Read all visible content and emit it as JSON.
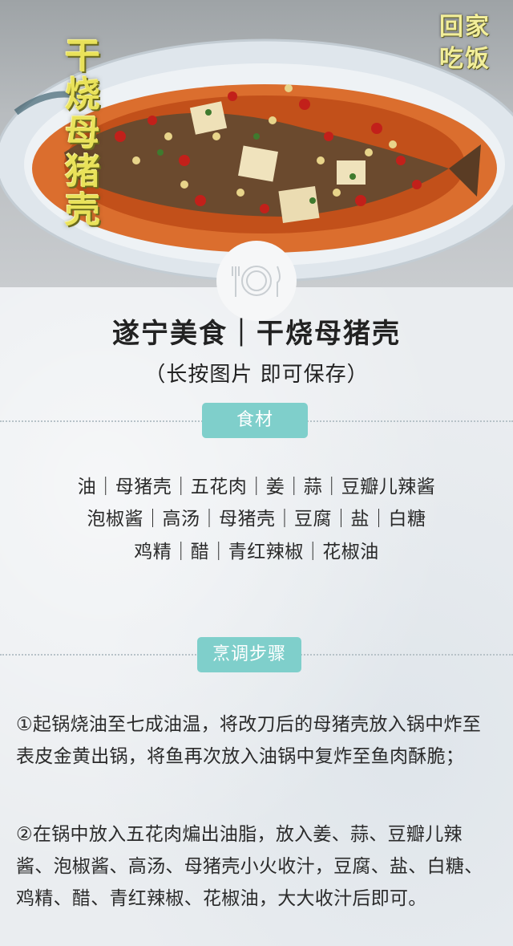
{
  "hero": {
    "dish_title": "干烧母猪壳",
    "logo_line1": "回家",
    "logo_line2": "吃饭",
    "colors": {
      "plate": "#dfe7ee",
      "sauce": "#d9631c",
      "title": "#e9e25a"
    }
  },
  "plate_icon": "plate-fork-knife-icon",
  "header": {
    "title": "遂宁美食｜干烧母猪壳",
    "subtitle": "（长按图片 即可保存）"
  },
  "ingredients": {
    "tag": "食材",
    "lines": [
      "油｜母猪壳｜五花肉｜姜｜蒜｜豆瓣儿辣酱",
      "泡椒酱｜高汤｜母猪壳｜豆腐｜盐｜白糖",
      "鸡精｜醋｜青红辣椒｜花椒油"
    ]
  },
  "steps": {
    "tag": "烹调步骤",
    "items": [
      "①起锅烧油至七成油温，将改刀后的母猪壳放入锅中炸至表皮金黄出锅，将鱼再次放入油锅中复炸至鱼肉酥脆；",
      "②在锅中放入五花肉煸出油脂，放入姜、蒜、豆瓣儿辣酱、泡椒酱、高汤、母猪壳小火收汁，豆腐、盐、白糖、鸡精、醋、青红辣椒、花椒油，大大收汁后即可。"
    ]
  },
  "theme": {
    "accent": "#7fcfcb",
    "background": "#eaedf0"
  }
}
